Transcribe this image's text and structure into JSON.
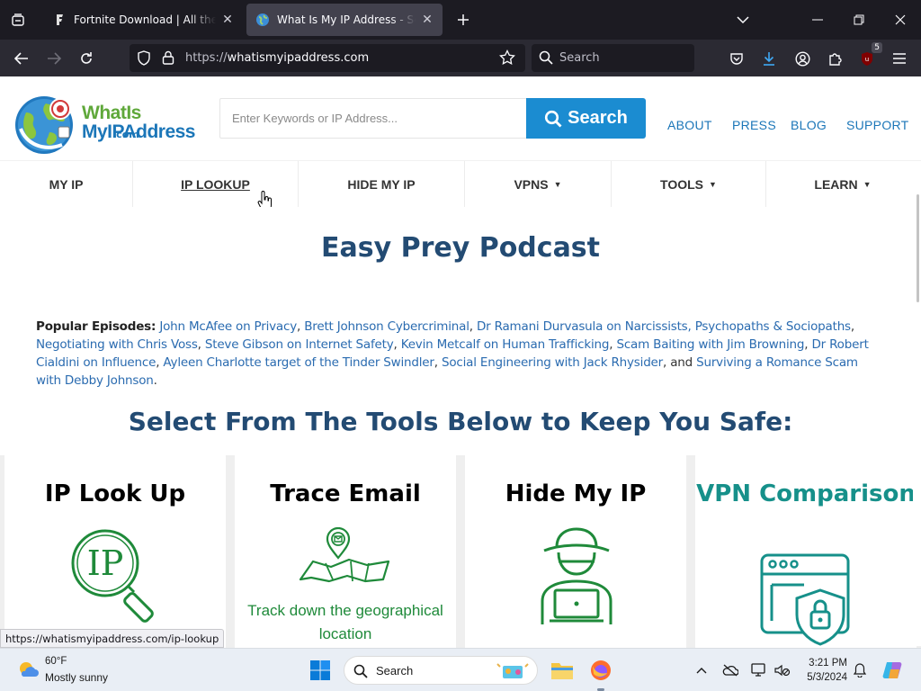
{
  "browser": {
    "tabs": [
      {
        "title": "Fortnite Download | All the Way",
        "active": false
      },
      {
        "title": "What Is My IP Address - See Yo",
        "active": true
      }
    ],
    "url_protocol": "https://",
    "url_host": "whatismyipaddress.com",
    "search_placeholder": "Search",
    "extension_badge": "5"
  },
  "site": {
    "logo": {
      "word1": "WhatIs",
      "word2": "MyIPAddress",
      "word3": ".com"
    },
    "search_placeholder": "Enter Keywords or IP Address...",
    "search_button": "Search",
    "top_links": [
      "ABOUT",
      "PRESS",
      "BLOG",
      "SUPPORT"
    ],
    "nav": [
      {
        "label": "MY IP",
        "caret": ""
      },
      {
        "label": "IP LOOKUP",
        "caret": ""
      },
      {
        "label": "HIDE MY IP",
        "caret": ""
      },
      {
        "label": "VPNS",
        "caret": "▼"
      },
      {
        "label": "TOOLS",
        "caret": "▼"
      },
      {
        "label": "LEARN",
        "caret": "▼"
      }
    ]
  },
  "content": {
    "podcast_heading": "Easy Prey Podcast",
    "episodes_label": "Popular Episodes:",
    "episodes": [
      "John McAfee on Privacy",
      "Brett Johnson Cybercriminal",
      "Dr Ramani Durvasula on Narcissists, Psychopaths & Sociopaths",
      "Negotiating with Chris Voss",
      "Steve Gibson on Internet Safety",
      "Kevin Metcalf on Human Trafficking",
      "Scam Baiting with Jim Browning",
      "Dr Robert Cialdini on Influence",
      "Ayleen Charlotte target of the Tinder Swindler",
      "Social Engineering with Jack Rhysider",
      "Surviving a Romance Scam with Debby Johnson"
    ],
    "episodes_sep": ", ",
    "episodes_and": ", and ",
    "episodes_end": ".",
    "tools_heading": "Select From The Tools Below to Keep You Safe:",
    "cards": [
      {
        "title": "IP Look Up",
        "color": "#1f8a3a",
        "desc": ""
      },
      {
        "title": "Trace Email",
        "color": "#1f8a3a",
        "desc": "Track down the geographical location"
      },
      {
        "title": "Hide My IP",
        "color": "#1f8a3a",
        "desc": ""
      },
      {
        "title": "VPN Comparison",
        "color": "#16908a",
        "desc": ""
      }
    ],
    "ip_icon_text": "IP"
  },
  "status_bar_link": "https://whatismyipaddress.com/ip-lookup",
  "taskbar": {
    "weather_temp": "60°F",
    "weather_desc": "Mostly sunny",
    "search_placeholder": "Search",
    "time": "3:21 PM",
    "date": "5/3/2024"
  },
  "colors": {
    "heading_blue": "#234b73",
    "link_blue": "#2a6bb0",
    "search_button_blue": "#1b8cd1",
    "card_green": "#1f8a3a",
    "card_teal": "#16908a"
  }
}
